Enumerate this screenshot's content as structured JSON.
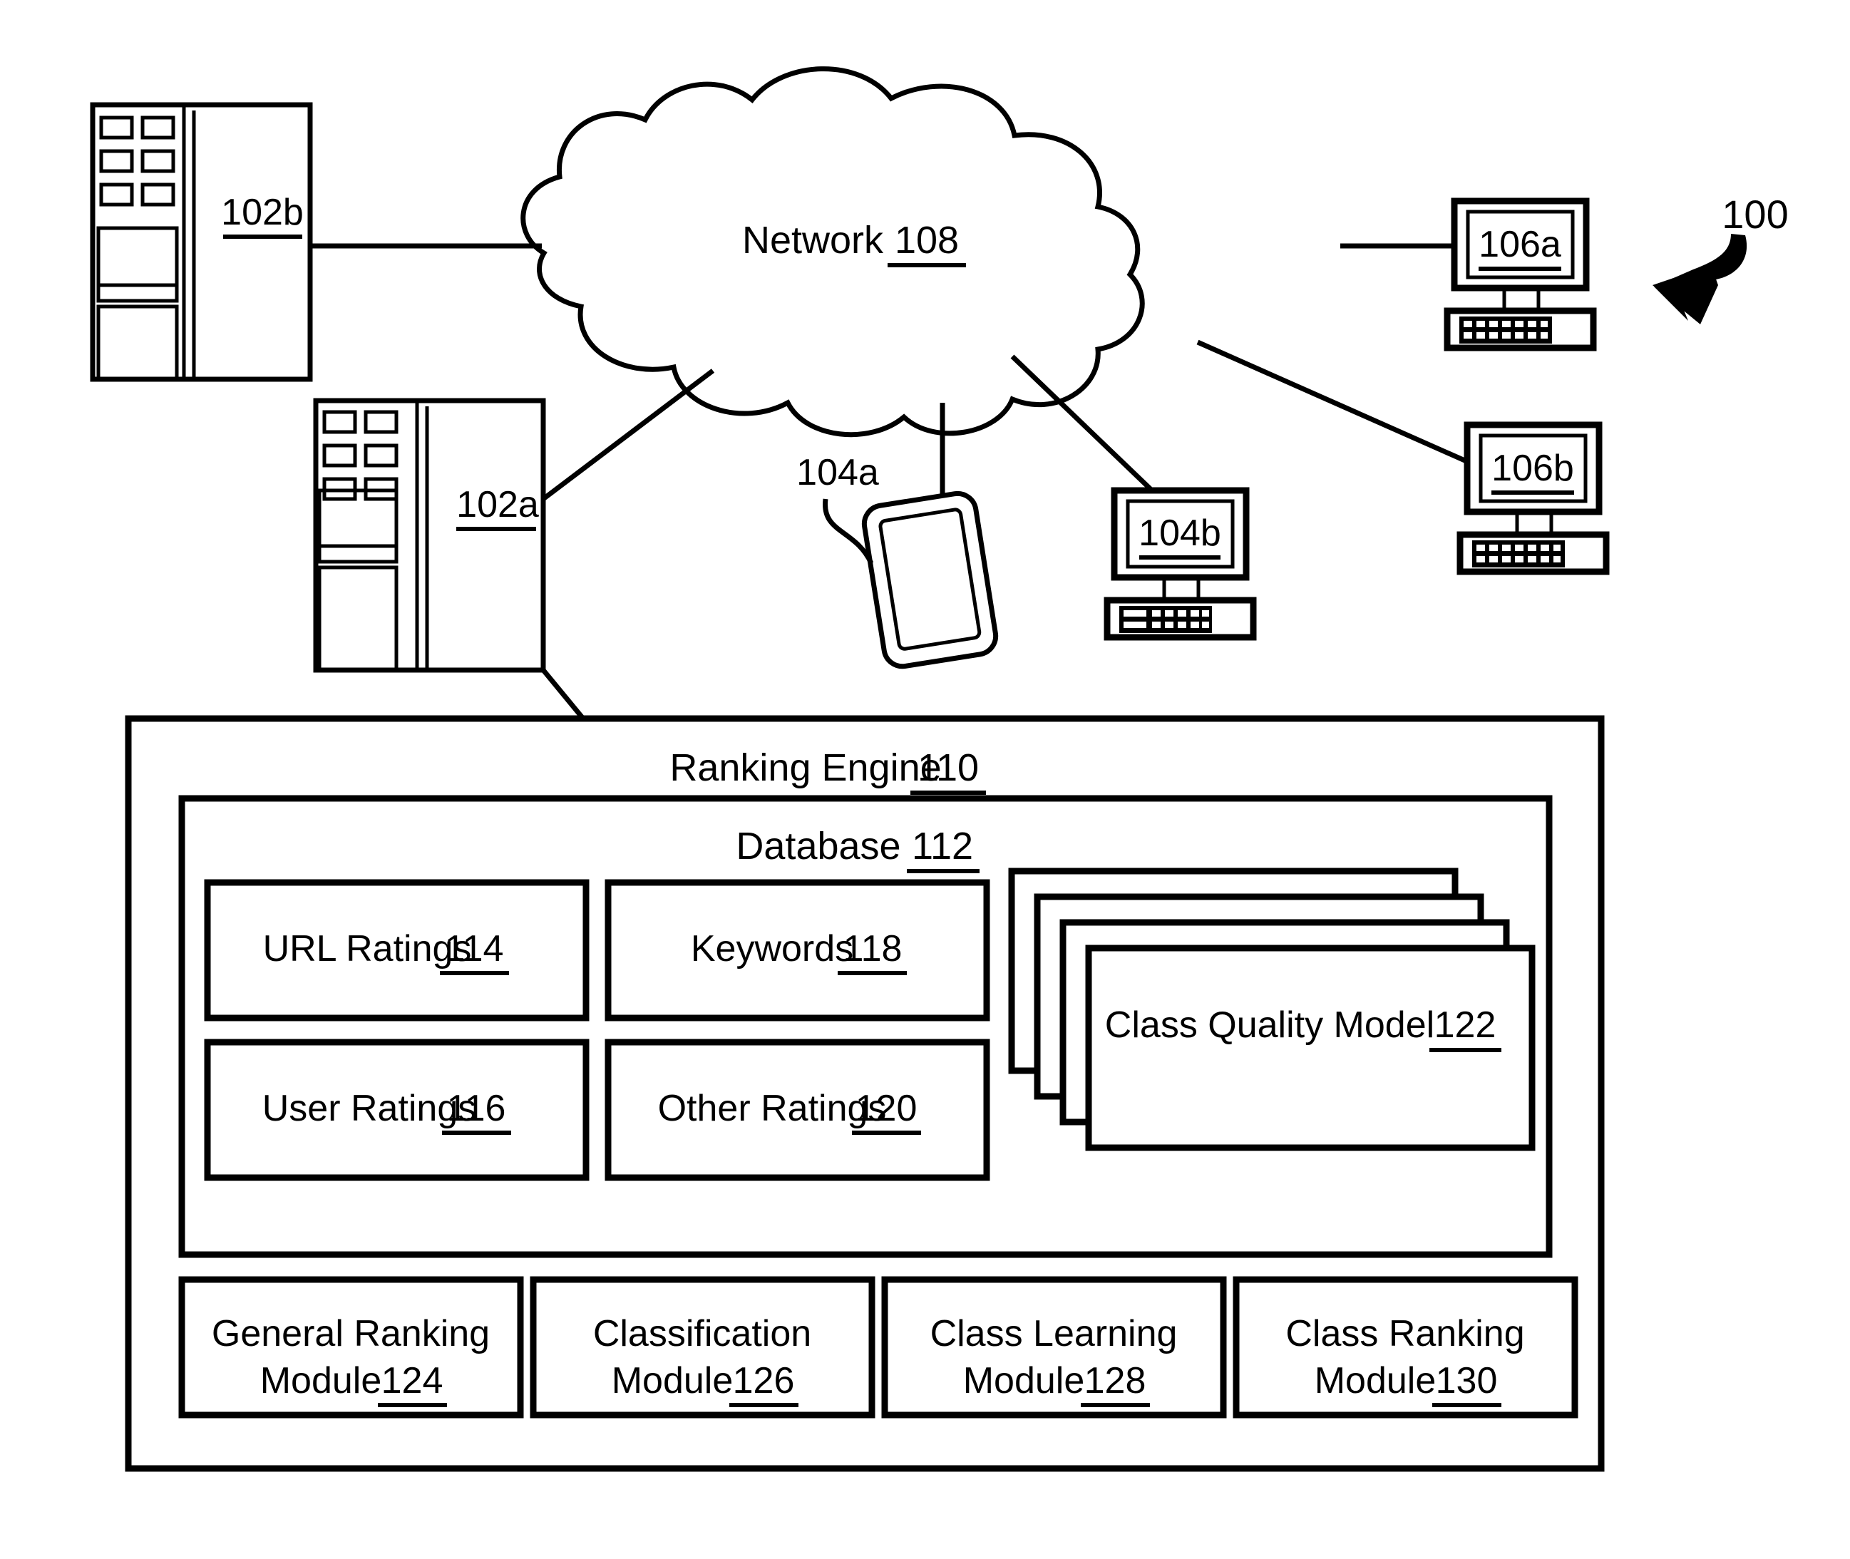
{
  "figure": {
    "figure_number": "100",
    "background": "#ffffff",
    "stroke_color": "#000000"
  },
  "network": {
    "label": "Network",
    "ref": "108"
  },
  "servers": [
    {
      "name": "server-102b",
      "ref": "102b"
    },
    {
      "name": "server-102a",
      "ref": "102a"
    }
  ],
  "clients": [
    {
      "name": "tablet-104a",
      "ref": "104a"
    },
    {
      "name": "desktop-104b",
      "ref": "104b"
    },
    {
      "name": "desktop-106a",
      "ref": "106a"
    },
    {
      "name": "desktop-106b",
      "ref": "106b"
    }
  ],
  "ranking_engine": {
    "title": "Ranking Engine",
    "ref": "110",
    "database": {
      "title": "Database",
      "ref": "112",
      "items": [
        {
          "label": "URL Ratings",
          "ref": "114"
        },
        {
          "label": "Keywords",
          "ref": "118"
        },
        {
          "label": "User Ratings",
          "ref": "116"
        },
        {
          "label": "Other Ratings",
          "ref": "120"
        }
      ],
      "stack": {
        "label": "Class Quality Model",
        "ref": "122",
        "layers": 4
      }
    },
    "modules": [
      {
        "line1": "General Ranking",
        "line2": "Module",
        "ref": "124"
      },
      {
        "line1": "Classification",
        "line2": "Module",
        "ref": "126"
      },
      {
        "line1": "Class Learning",
        "line2": "Module",
        "ref": "128"
      },
      {
        "line1": "Class Ranking",
        "line2": "Module",
        "ref": "130"
      }
    ]
  }
}
